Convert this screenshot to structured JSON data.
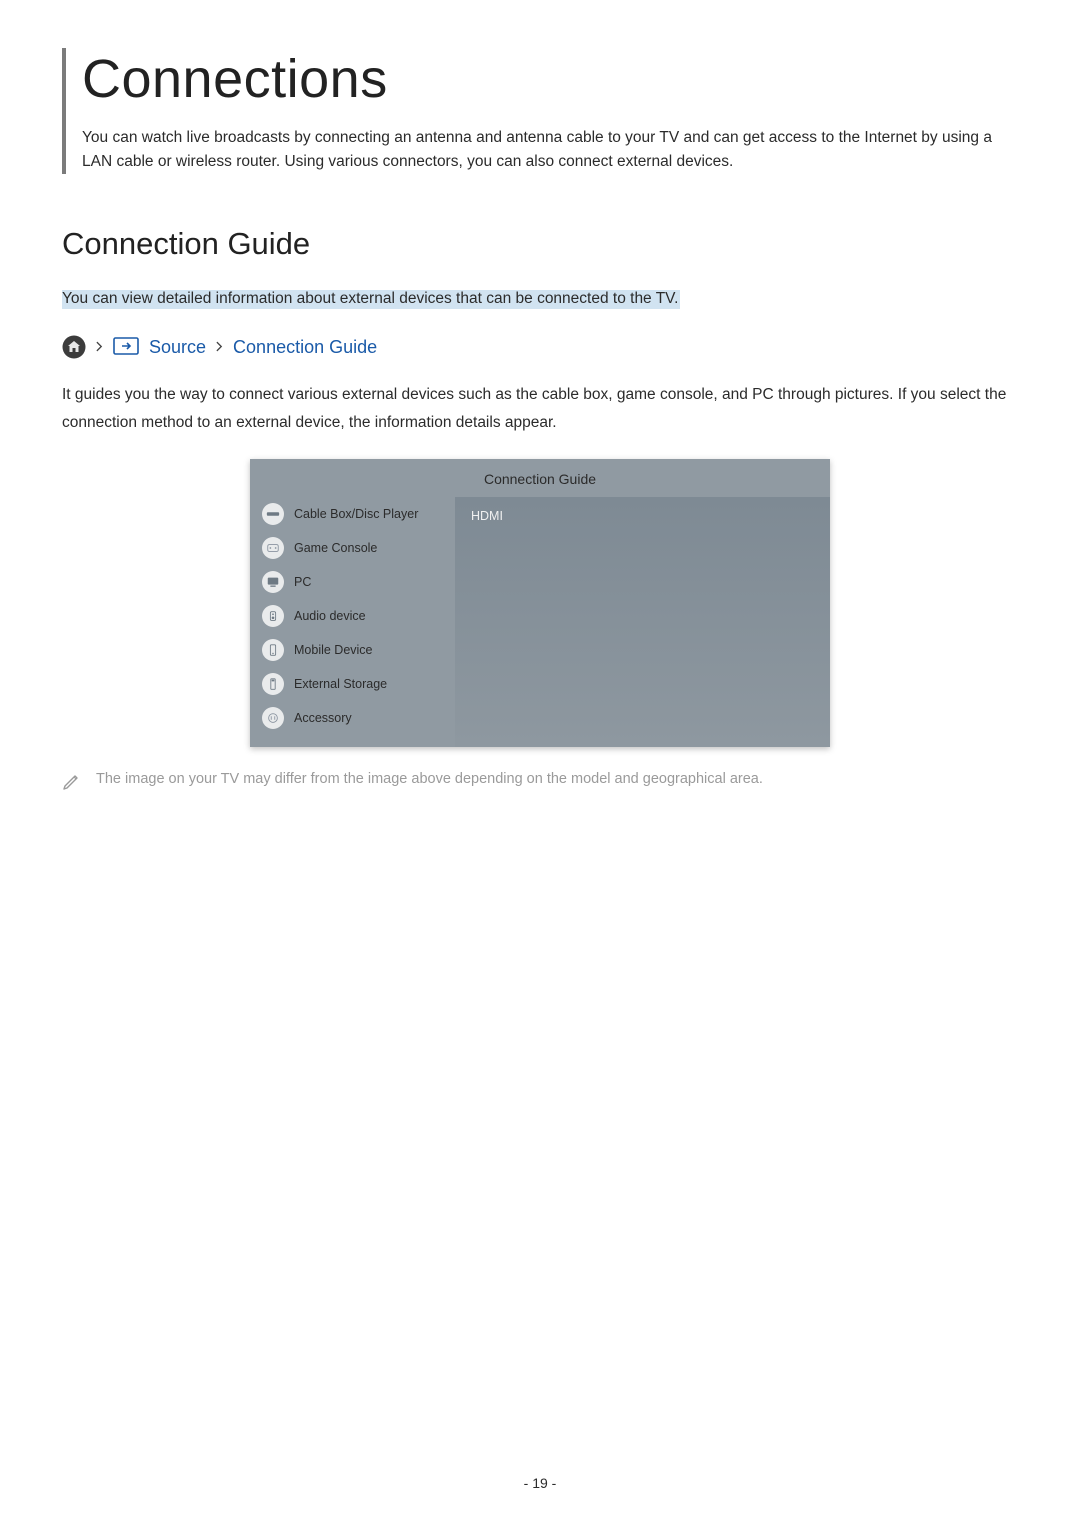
{
  "title": "Connections",
  "intro": "You can watch live broadcasts by connecting an antenna and antenna cable to your TV and can get access to the Internet by using a LAN cable or wireless router. Using various connectors, you can also connect external devices.",
  "section": {
    "heading": "Connection Guide",
    "summary": "You can view detailed information about external devices that can be connected to the TV.",
    "nav": {
      "source": "Source",
      "guide": "Connection Guide"
    },
    "body": "It guides you the way to connect various external devices such as the cable box, game console, and PC through pictures. If you select the connection method to an external device, the information details appear."
  },
  "tv": {
    "header": "Connection Guide",
    "items": [
      {
        "icon": "disc-icon",
        "label": "Cable Box/Disc Player",
        "selected": true
      },
      {
        "icon": "gamepad-icon",
        "label": "Game Console",
        "selected": false
      },
      {
        "icon": "pc-icon",
        "label": "PC",
        "selected": false
      },
      {
        "icon": "audio-icon",
        "label": "Audio device",
        "selected": false
      },
      {
        "icon": "mobile-icon",
        "label": "Mobile Device",
        "selected": false
      },
      {
        "icon": "storage-icon",
        "label": "External Storage",
        "selected": false
      },
      {
        "icon": "accessory-icon",
        "label": "Accessory",
        "selected": false
      }
    ],
    "detail": "HDMI"
  },
  "note": "The image on your TV may differ from the image above depending on the model and geographical area.",
  "page_number": "- 19 -"
}
